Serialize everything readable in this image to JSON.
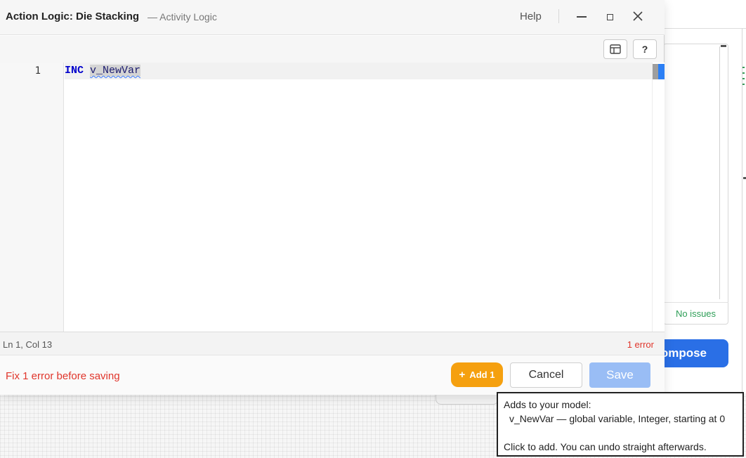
{
  "window": {
    "title": "Action Logic: Die Stacking",
    "subtitle": "— Activity Logic",
    "help_label": "Help",
    "close_glyph": "✕"
  },
  "toolbar": {
    "layout_icon": "layout-icon",
    "help_label": "?"
  },
  "editor": {
    "line_number": "1",
    "keyword": "INC",
    "variable": "v_NewVar",
    "keyword_color": "#0000cc",
    "error_underline_color": "#3b7bff"
  },
  "status": {
    "cursor": "Ln 1, Col 13",
    "errors": "1 error",
    "error_color": "#e0352b"
  },
  "footer": {
    "message": "Fix 1 error before saving",
    "add_label": "Add 1",
    "add_plus": "+",
    "cancel_label": "Cancel",
    "save_label": "Save"
  },
  "tooltip": {
    "line1": "Adds to your model:",
    "line2": "v_NewVar — global variable, Integer, starting at 0",
    "line3": "Click to add. You can undo straight afterwards."
  },
  "background": {
    "status_text": "No issues",
    "compose_label": "ompose",
    "accent_color": "#2a6fe6",
    "ok_color": "#2e9e57"
  }
}
